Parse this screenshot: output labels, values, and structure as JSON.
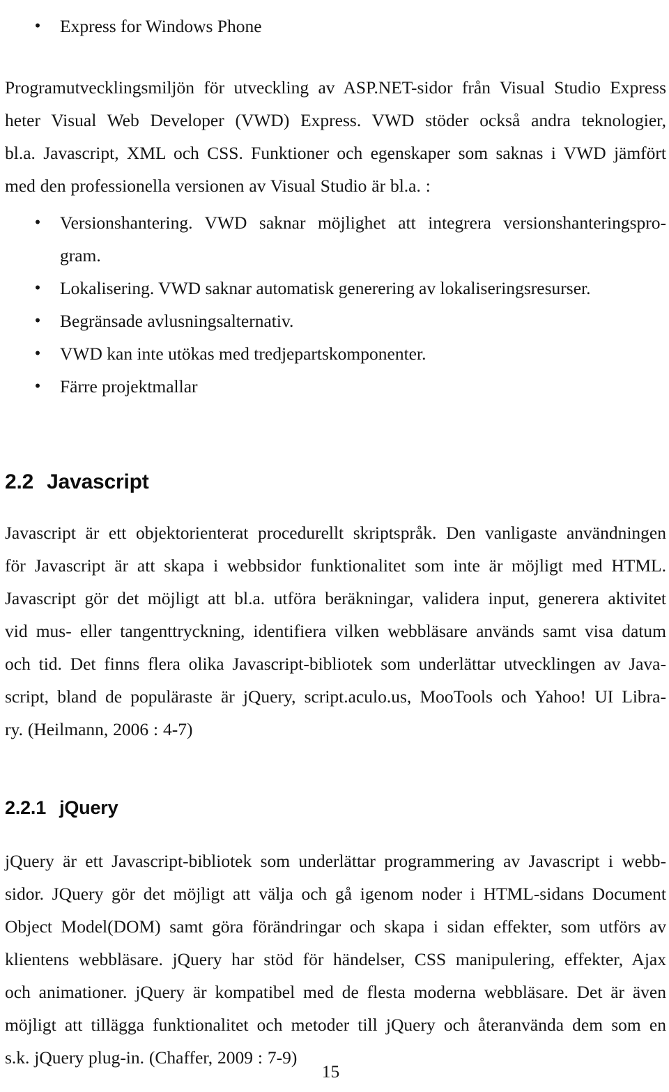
{
  "document": {
    "page_number": "15",
    "language": "sv",
    "heading_numbers": {
      "section": "2.2",
      "subsection": "2.2.1"
    }
  },
  "bullets_top": {
    "items": [
      {
        "bullet_glyph": "•",
        "text": "Express for Windows Phone"
      }
    ]
  },
  "paragraph_vwd": {
    "lines": [
      "Programutvecklingsmiljön för utveckling av ASP.NET-sidor från Visual Studio Express",
      "heter Visual Web Developer (VWD) Express. VWD stöder också andra teknologier,",
      "bl.a. Javascript, XML och CSS. Funktioner och egenskaper som saknas i VWD jämfört",
      "med den professionella versionen av Visual Studio är bl.a. :"
    ]
  },
  "bullets_vwd": {
    "items": [
      {
        "bullet_glyph": "•",
        "lines": [
          "Versionshantering. VWD saknar möjlighet att integrera versionshanteringspro-",
          "gram."
        ]
      },
      {
        "bullet_glyph": "•",
        "lines": [
          "Lokalisering. VWD saknar automatisk generering av lokaliseringsresurser."
        ]
      },
      {
        "bullet_glyph": "•",
        "lines": [
          "Begränsade avlusningsalternativ."
        ]
      },
      {
        "bullet_glyph": "•",
        "lines": [
          "VWD kan inte utökas med tredjepartskomponenter."
        ]
      },
      {
        "bullet_glyph": "•",
        "lines": [
          "Färre projektmallar"
        ]
      }
    ]
  },
  "heading_javascript": {
    "number": "2.2",
    "title": "Javascript"
  },
  "paragraph_javascript": {
    "lines": [
      "Javascript är ett objektorienterat procedurellt skriptspråk. Den vanligaste användningen",
      "för Javascript är att skapa i webbsidor funktionalitet som inte är möjligt med HTML.",
      "Javascript gör det möjligt att bl.a. utföra beräkningar, validera input, generera aktivitet",
      "vid mus- eller tangenttryckning, identifiera vilken webbläsare används samt visa datum",
      "och tid. Det finns flera olika Javascript-bibliotek som underlättar utvecklingen av Java-",
      "script, bland de populäraste är jQuery, script.aculo.us, MooTools och Yahoo! UI Libra-",
      "ry. (Heilmann, 2006 : 4-7)"
    ]
  },
  "heading_jquery": {
    "number": "2.2.1",
    "title": "jQuery"
  },
  "paragraph_jquery": {
    "lines": [
      "jQuery är ett Javascript-bibliotek som underlättar programmering av Javascript i webb-",
      "sidor. JQuery gör det möjligt att välja och gå igenom noder i HTML-sidans Document",
      "Object Model(DOM) samt göra förändringar och skapa i sidan effekter, som utförs av",
      "klientens webbläsare. jQuery har stöd för händelser, CSS manipulering, effekter, Ajax",
      "och animationer. jQuery är kompatibel med de flesta moderna webbläsare. Det är även",
      "möjligt att tillägga funktionalitet och metoder till jQuery och återanvända dem som en",
      "s.k. jQuery plug-in. (Chaffer, 2009 : 7-9)"
    ]
  }
}
